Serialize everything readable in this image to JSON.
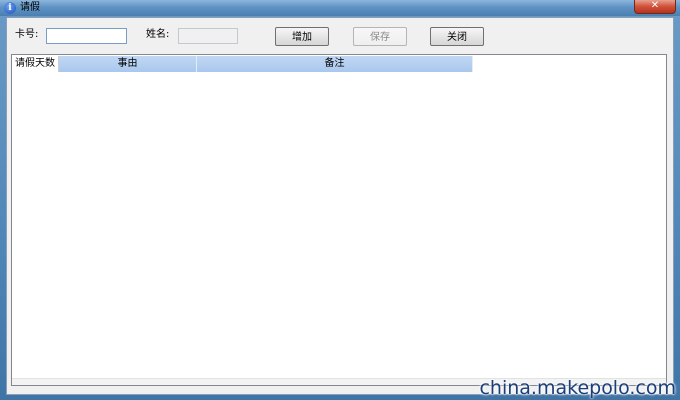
{
  "window": {
    "title": "请假",
    "icon": "info-icon",
    "close_label": "✕"
  },
  "toolbar": {
    "card_label": "卡号:",
    "card_value": "",
    "name_label": "姓名:",
    "name_value": "",
    "add_label": "增加",
    "save_label": "保存",
    "close_label": "关闭"
  },
  "grid": {
    "columns": [
      "请假天数",
      "事由",
      "备注"
    ],
    "rows": []
  },
  "watermark": "china.makepolo.com",
  "colors": {
    "header_fill": "#a9c8ee",
    "title_bar": "#5f93c4",
    "close_button": "#d0513a"
  }
}
